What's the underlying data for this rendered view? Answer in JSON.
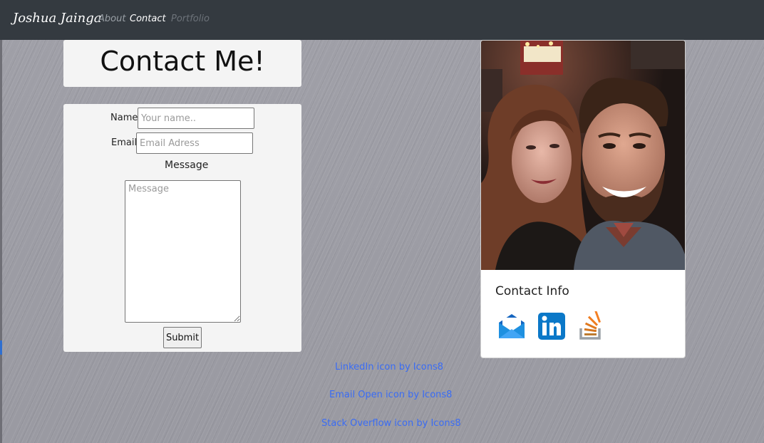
{
  "nav": {
    "brand": "Joshua Jainga",
    "links": [
      {
        "label": "About"
      },
      {
        "label": "Contact"
      },
      {
        "label": "Portfolio"
      }
    ]
  },
  "title_card": {
    "heading": "Contact Me!"
  },
  "form": {
    "name_label": "Name",
    "name_placeholder": "Your name..",
    "name_value": "",
    "email_label": "Email",
    "email_placeholder": "Email Adress",
    "email_value": "",
    "message_label": "Message",
    "message_placeholder": "Message",
    "message_value": "",
    "submit_label": "Submit"
  },
  "profile": {
    "contact_info_title": "Contact Info",
    "icons": [
      "email-open-icon",
      "linkedin-icon",
      "stack-overflow-icon"
    ]
  },
  "credits": [
    "LinkedIn icon by Icons8",
    "Email Open icon by Icons8",
    "Stack Overflow icon by Icons8"
  ],
  "colors": {
    "navbar": "#343a40",
    "link": "#3a6cf4",
    "card": "#f4f4f4",
    "linkedin": "#0b78c8",
    "stack_orange": "#f48024",
    "email_blue": "#1e90e0"
  }
}
